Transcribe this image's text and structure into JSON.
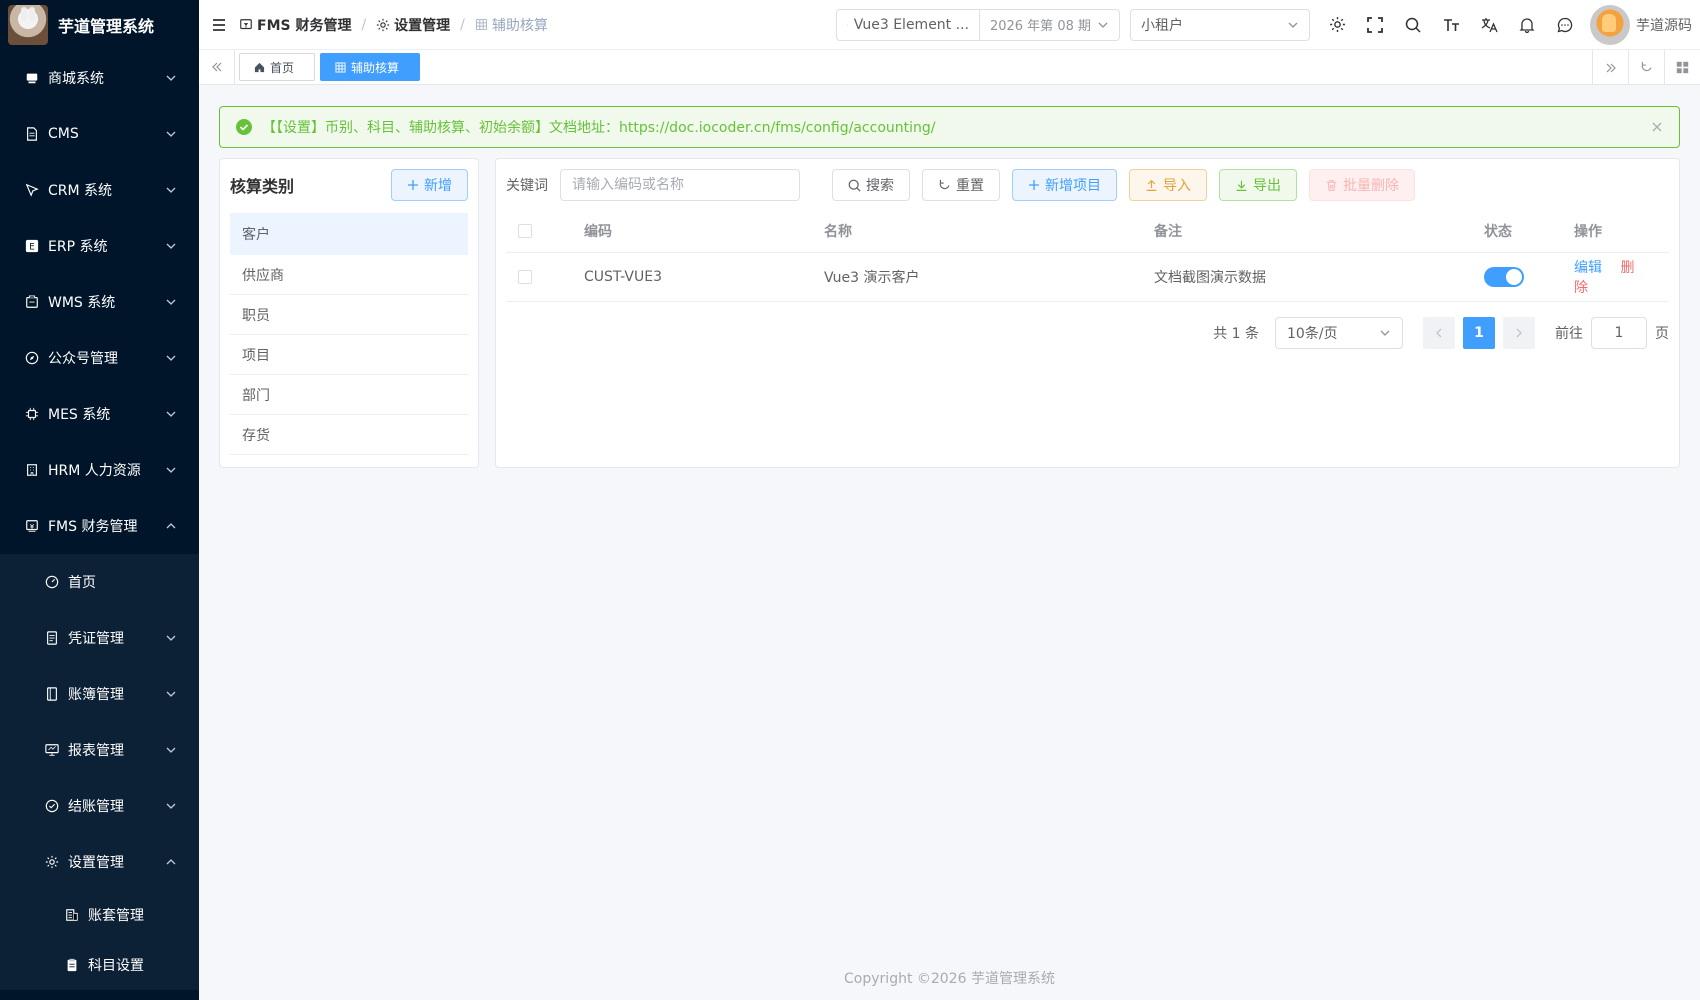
{
  "app": {
    "title": "芋道管理系统"
  },
  "sidebar": {
    "items": [
      {
        "label": "商城系统",
        "icon": "shop-icon"
      },
      {
        "label": "CMS",
        "icon": "document-icon"
      },
      {
        "label": "CRM 系统",
        "icon": "crm-icon"
      },
      {
        "label": "ERP 系统",
        "icon": "erp-icon"
      },
      {
        "label": "WMS 系统",
        "icon": "warehouse-icon"
      },
      {
        "label": "公众号管理",
        "icon": "compass-icon"
      },
      {
        "label": "MES 系统",
        "icon": "chip-icon"
      },
      {
        "label": "HRM 人力资源",
        "icon": "building-icon"
      },
      {
        "label": "FMS 财务管理",
        "icon": "finance-icon"
      }
    ],
    "fms_children": [
      {
        "label": "首页",
        "icon": "dashboard-icon"
      },
      {
        "label": "凭证管理",
        "icon": "voucher-icon"
      },
      {
        "label": "账簿管理",
        "icon": "book-icon"
      },
      {
        "label": "报表管理",
        "icon": "report-icon"
      },
      {
        "label": "结账管理",
        "icon": "check-circle-icon"
      },
      {
        "label": "设置管理",
        "icon": "gear-icon"
      }
    ],
    "settings_children": [
      {
        "label": "账套管理",
        "icon": "ledger-icon"
      },
      {
        "label": "科目设置",
        "icon": "clipboard-icon"
      }
    ]
  },
  "header": {
    "breadcrumb": [
      "FMS 财务管理",
      "设置管理",
      "辅助核算"
    ],
    "ledger_name": "Vue3 Element ...",
    "period": "2026 年第 08 期",
    "tenant": "小租户",
    "user_name": "芋道源码"
  },
  "tags": [
    {
      "label": "首页",
      "active": false
    },
    {
      "label": "辅助核算",
      "active": true
    }
  ],
  "alert": {
    "text": "【【设置】币别、科目、辅助核算、初始余额】文档地址：https://doc.iocoder.cn/fms/config/accounting/"
  },
  "categories": {
    "title": "核算类别",
    "add_label": "新增",
    "items": [
      "客户",
      "供应商",
      "职员",
      "项目",
      "部门",
      "存货"
    ],
    "active_index": 0
  },
  "toolbar": {
    "keyword_label": "关键词",
    "keyword_placeholder": "请输入编码或名称",
    "keyword_value": "",
    "search_label": "搜索",
    "reset_label": "重置",
    "add_item_label": "新增项目",
    "import_label": "导入",
    "export_label": "导出",
    "batch_delete_label": "批量删除"
  },
  "table": {
    "columns": [
      "编码",
      "名称",
      "备注",
      "状态",
      "操作"
    ],
    "rows": [
      {
        "code": "CUST-VUE3",
        "name": "Vue3 演示客户",
        "remark": "文档截图演示数据",
        "enabled": true,
        "edit": "编辑",
        "delete": "删除"
      }
    ]
  },
  "pagination": {
    "total_text": "共 1 条",
    "page_size": "10条/页",
    "current_page": "1",
    "goto_label": "前往",
    "goto_value": "1",
    "page_unit": "页"
  },
  "footer": {
    "copyright": "Copyright ©2026 芋道管理系统"
  },
  "colors": {
    "sidebar_bg": "#001529",
    "primary": "#409eff",
    "success": "#67c23a",
    "warning": "#e6a23c",
    "danger": "#f56c6c"
  }
}
